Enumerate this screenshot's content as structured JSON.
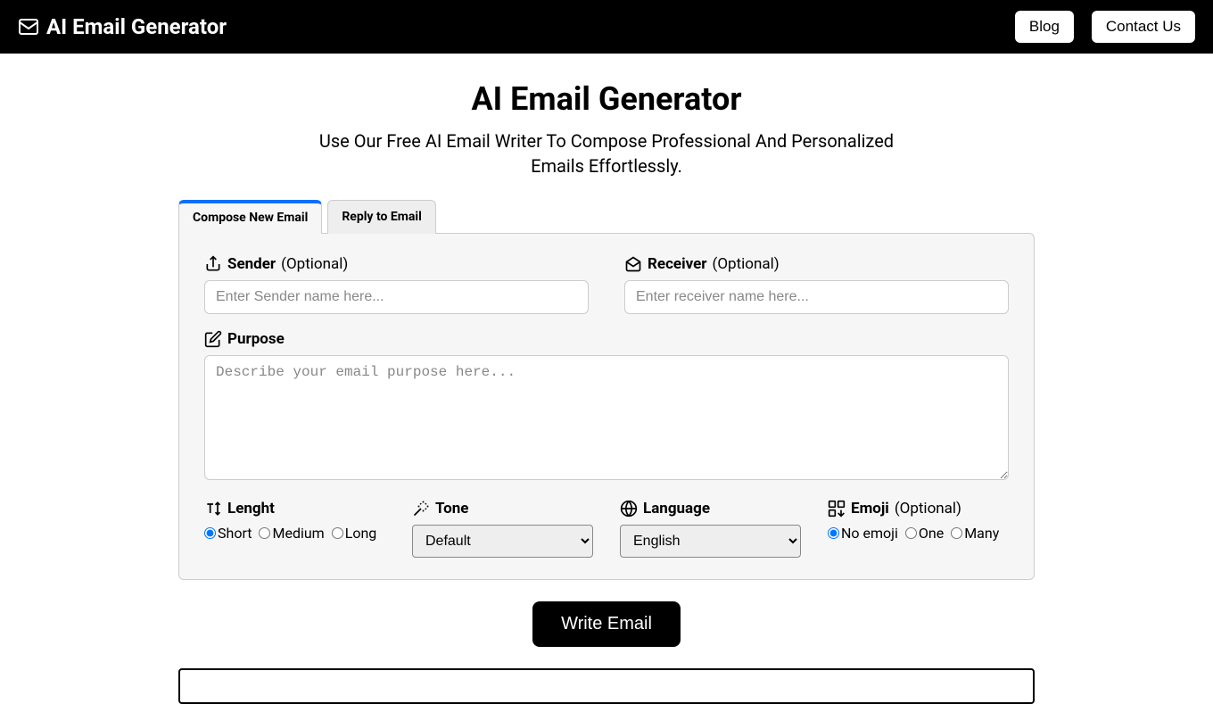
{
  "header": {
    "brand": "AI Email Generator",
    "blog": "Blog",
    "contact": "Contact Us"
  },
  "page": {
    "title": "AI Email Generator",
    "subtitle": "Use Our Free AI Email Writer To Compose Professional And Personalized Emails Effortlessly."
  },
  "tabs": {
    "compose": "Compose New Email",
    "reply": "Reply to Email"
  },
  "form": {
    "sender_label": "Sender",
    "sender_optional": "(Optional)",
    "sender_placeholder": "Enter Sender name here...",
    "receiver_label": "Receiver",
    "receiver_optional": "(Optional)",
    "receiver_placeholder": "Enter receiver name here...",
    "purpose_label": "Purpose",
    "purpose_placeholder": "Describe your email purpose here...",
    "length_label": "Lenght",
    "length_short": "Short",
    "length_medium": "Medium",
    "length_long": "Long",
    "tone_label": "Tone",
    "tone_value": "Default",
    "language_label": "Language",
    "language_value": "English",
    "emoji_label": "Emoji",
    "emoji_optional": "(Optional)",
    "emoji_none": "No emoji",
    "emoji_one": "One",
    "emoji_many": "Many"
  },
  "actions": {
    "write": "Write Email"
  }
}
